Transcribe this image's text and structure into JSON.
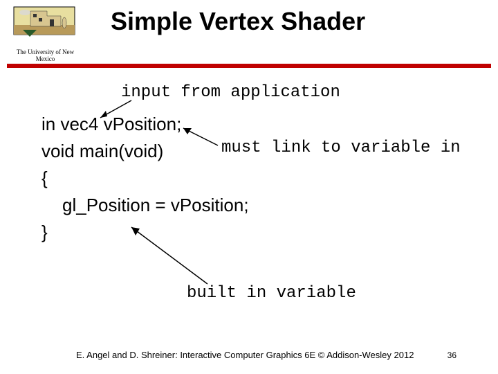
{
  "header": {
    "logo_caption": "The University of New Mexico",
    "title": "Simple Vertex Shader"
  },
  "annotations": {
    "input_note": "input from application",
    "link_note": "must link to variable in",
    "builtin_note": "built in variable"
  },
  "code": {
    "line1": "in vec4 vPosition;",
    "line2": "void main(void)",
    "line3": "{",
    "line4": "gl_Position = vPosition;",
    "line5": "}"
  },
  "footer": {
    "credit": "E. Angel and D. Shreiner: Interactive Computer Graphics 6E © Addison-Wesley 2012",
    "page": "36"
  }
}
